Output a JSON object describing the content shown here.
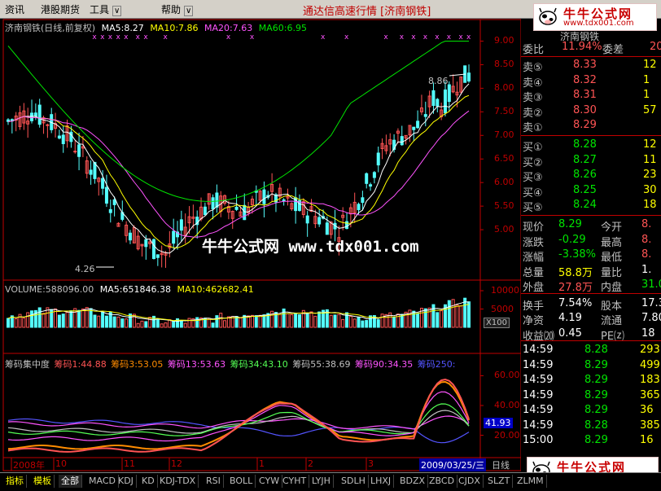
{
  "menu": [
    "资讯",
    "港股期货",
    "工具",
    "帮助"
  ],
  "app_title": "通达信高速行情 [济南钢铁]",
  "logo": {
    "text": "牛牛公式网",
    "url": "www.tdx001.com"
  },
  "watermark": "牛牛公式网 www.tdx001.com",
  "header": {
    "stock": "济南钢铁(日线,前复权)",
    "ma5": "MA5:8.27",
    "ma10": "MA10:7.86",
    "ma20": "MA20:7.63",
    "ma60": "MA60:6.95"
  },
  "price_axis": [
    "9.00",
    "8.50",
    "8.00",
    "7.50",
    "7.00",
    "6.50",
    "6.00",
    "5.50",
    "5.00"
  ],
  "annotations": {
    "high": "8.86",
    "low": "4.26"
  },
  "volume_header": {
    "volume": "VOLUME:588096.00",
    "ma5": "MA5:651846.38",
    "ma10": "MA10:462682.41"
  },
  "volume_axis": [
    "10000",
    "5000"
  ],
  "volume_unit": "X100",
  "chips_header": {
    "title": "筹码集中度",
    "c1": "筹码1:44.88",
    "c2": "筹码3:53.05",
    "c3": "筹码13:53.63",
    "c4": "筹码34:43.10",
    "c5": "筹码55:38.69",
    "c6": "筹码90:34.35",
    "c7": "筹码250:"
  },
  "chips_axis": [
    "60.00",
    "40.00",
    "20.00"
  ],
  "chips_current": "41.93",
  "date_axis": [
    "2008年",
    "10",
    "11",
    "12",
    "1",
    "2",
    "3"
  ],
  "date_cursor": "2009/03/25/三",
  "period": "日线",
  "tabs": [
    "指标",
    "模板",
    "全部",
    "MACD",
    "KDJ",
    "KD",
    "KDJ-TDX",
    "RSI",
    "BOLL",
    "CYW",
    "CYHT",
    "LYJH",
    "SDLH",
    "LHXJ",
    "BDZX",
    "ZBCD",
    "CJDX",
    "SLZT",
    "ZLMM"
  ],
  "panel": {
    "top_label": "济南钢铁",
    "weibi_label": "委比",
    "weibi": "11.94%",
    "weicha_label": "委差",
    "weicha": "20",
    "sells": [
      {
        "label": "卖⑤",
        "price": "8.33",
        "vol": "12"
      },
      {
        "label": "卖④",
        "price": "8.32",
        "vol": "1"
      },
      {
        "label": "卖③",
        "price": "8.31",
        "vol": "1"
      },
      {
        "label": "卖②",
        "price": "8.30",
        "vol": "57"
      },
      {
        "label": "卖①",
        "price": "8.29",
        "vol": ""
      }
    ],
    "buys": [
      {
        "label": "买①",
        "price": "8.28",
        "vol": "12"
      },
      {
        "label": "买②",
        "price": "8.27",
        "vol": "11"
      },
      {
        "label": "买③",
        "price": "8.26",
        "vol": "23"
      },
      {
        "label": "买④",
        "price": "8.25",
        "vol": "30"
      },
      {
        "label": "买⑤",
        "price": "8.24",
        "vol": "18"
      }
    ],
    "quote": [
      {
        "l1": "现价",
        "v1": "8.29",
        "l2": "今开",
        "v2": "8."
      },
      {
        "l1": "涨跌",
        "v1": "-0.29",
        "l2": "最高",
        "v2": "8."
      },
      {
        "l1": "涨幅",
        "v1": "-3.38%",
        "l2": "最低",
        "v2": "8."
      },
      {
        "l1": "总量",
        "v1": "58.8万",
        "l2": "量比",
        "v2": "1."
      },
      {
        "l1": "外盘",
        "v1": "27.8万",
        "l2": "内盘",
        "v2": "31.0"
      },
      {
        "l1": "换手",
        "v1": "7.54%",
        "l2": "股本",
        "v2": "17.3"
      },
      {
        "l1": "净资",
        "v1": "4.19",
        "l2": "流通",
        "v2": "7.80"
      },
      {
        "l1": "收益⒇",
        "v1": "0.45",
        "l2": "PE⒵",
        "v2": "18"
      }
    ],
    "ticks": [
      {
        "t": "14:59",
        "p": "8.28",
        "v": "293"
      },
      {
        "t": "14:59",
        "p": "8.29",
        "v": "499"
      },
      {
        "t": "14:59",
        "p": "8.29",
        "v": "183"
      },
      {
        "t": "14:59",
        "p": "8.29",
        "v": "365"
      },
      {
        "t": "14:59",
        "p": "8.29",
        "v": "36"
      },
      {
        "t": "14:59",
        "p": "8.28",
        "v": "385"
      },
      {
        "t": "15:00",
        "p": "8.29",
        "v": "16"
      }
    ]
  },
  "colors": {
    "up": "#ff5454",
    "down": "#54ffff",
    "ma5": "#ffffff",
    "ma10": "#ffff00",
    "ma20": "#ff54ff",
    "ma60": "#00e400",
    "axis": "#c00000"
  }
}
